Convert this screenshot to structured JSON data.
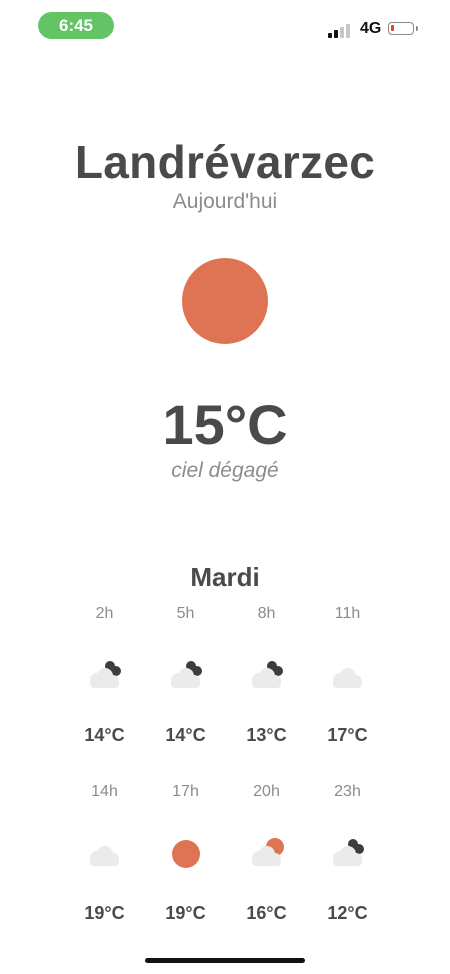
{
  "status_bar": {
    "time": "6:45",
    "network": "4G",
    "signal_bars_active": 2,
    "battery_level_percent": 5,
    "colors": {
      "time_pill": "#63c466",
      "battery_low": "#e2413a"
    }
  },
  "location": {
    "city": "Landrévarzec",
    "day_label": "Aujourd'hui"
  },
  "current": {
    "icon": "sun-icon",
    "temperature": "15°C",
    "condition": "ciel dégagé",
    "icon_color": "#df7455"
  },
  "forecast": {
    "day": "Mardi",
    "slots": [
      {
        "hour": "2h",
        "icon": "cloud-night-icon",
        "temp": "14°C"
      },
      {
        "hour": "5h",
        "icon": "cloud-night-icon",
        "temp": "14°C"
      },
      {
        "hour": "8h",
        "icon": "cloud-night-icon",
        "temp": "13°C"
      },
      {
        "hour": "11h",
        "icon": "cloud-icon",
        "temp": "17°C"
      },
      {
        "hour": "14h",
        "icon": "cloud-icon",
        "temp": "19°C"
      },
      {
        "hour": "17h",
        "icon": "sun-icon",
        "temp": "19°C"
      },
      {
        "hour": "20h",
        "icon": "sun-cloud-icon",
        "temp": "16°C"
      },
      {
        "hour": "23h",
        "icon": "cloud-night-icon",
        "temp": "12°C"
      }
    ]
  }
}
